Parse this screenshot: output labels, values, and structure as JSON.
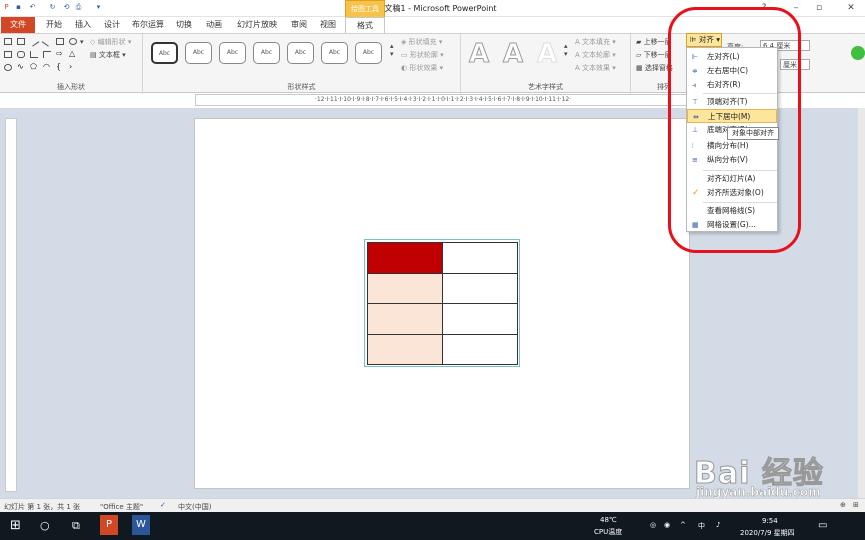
{
  "window": {
    "title": "演示文稿1 - Microsoft PowerPoint",
    "context_tab_group": "绘图工具"
  },
  "tabs": [
    "文件",
    "开始",
    "插入",
    "设计",
    "布尔运算",
    "切换",
    "动画",
    "幻灯片放映",
    "审阅",
    "视图",
    "格式"
  ],
  "ribbon": {
    "insert_shapes": {
      "label": "插入形状",
      "edit_shape": "编辑形状",
      "text_box": "文本框"
    },
    "shape_styles": {
      "label": "形状样式",
      "swatch_text": "Abc",
      "fill": "形状填充",
      "outline": "形状轮廓",
      "effects": "形状效果"
    },
    "wordart": {
      "label": "艺术字样式",
      "text_fill": "文本填充",
      "text_outline": "文本轮廓",
      "text_effects": "文本效果",
      "letter": "A"
    },
    "arrange": {
      "label": "排列",
      "bring_forward": "上移一层",
      "send_backward": "下移一层",
      "selection_pane": "选择窗格",
      "align": "对齐"
    },
    "size": {
      "height_label": "高度:",
      "height_value": "6.4 厘米",
      "width_value": "厘米"
    }
  },
  "align_menu": {
    "items": [
      "左对齐(L)",
      "左右居中(C)",
      "右对齐(R)",
      "顶端对齐(T)",
      "上下居中(M)",
      "底端对齐(B)",
      "横向分布(H)",
      "纵向分布(V)",
      "对齐幻灯片(A)",
      "对齐所选对象(O)",
      "查看网格线(S)",
      "网格设置(G)..."
    ],
    "highlighted": "上下居中(M)",
    "checked": "对齐所选对象(O)",
    "tooltip": "对象中部对齐"
  },
  "ruler_h": "·12·I·11·I·10·I·9·I·8·I·7·I·6·I·5·I·4·I·3·I·2·I·1·I·0·I·1·I·2·I·3·I·4·I·5·I·6·I·7·I·8·I·9·I·10·I·11·I·12·",
  "status": {
    "slide_info": "幻灯片 第 1 张，共 1 张",
    "theme": "\"Office 主题\"",
    "language": "中文(中国)"
  },
  "taskbar": {
    "temp": "48℃",
    "cpu_label": "CPU温度",
    "ime": "中",
    "time": "9:54",
    "date": "2020/7/9 星期四"
  },
  "watermark": {
    "text": "Bai 经验",
    "url": "jingyan.baidu.com"
  },
  "colors": {
    "header_red": "#c00000",
    "body_peach": "#fbe5d6",
    "menu_highlight": "#fde59c",
    "file_tab": "#d24726",
    "annotation": "#e8101a"
  }
}
